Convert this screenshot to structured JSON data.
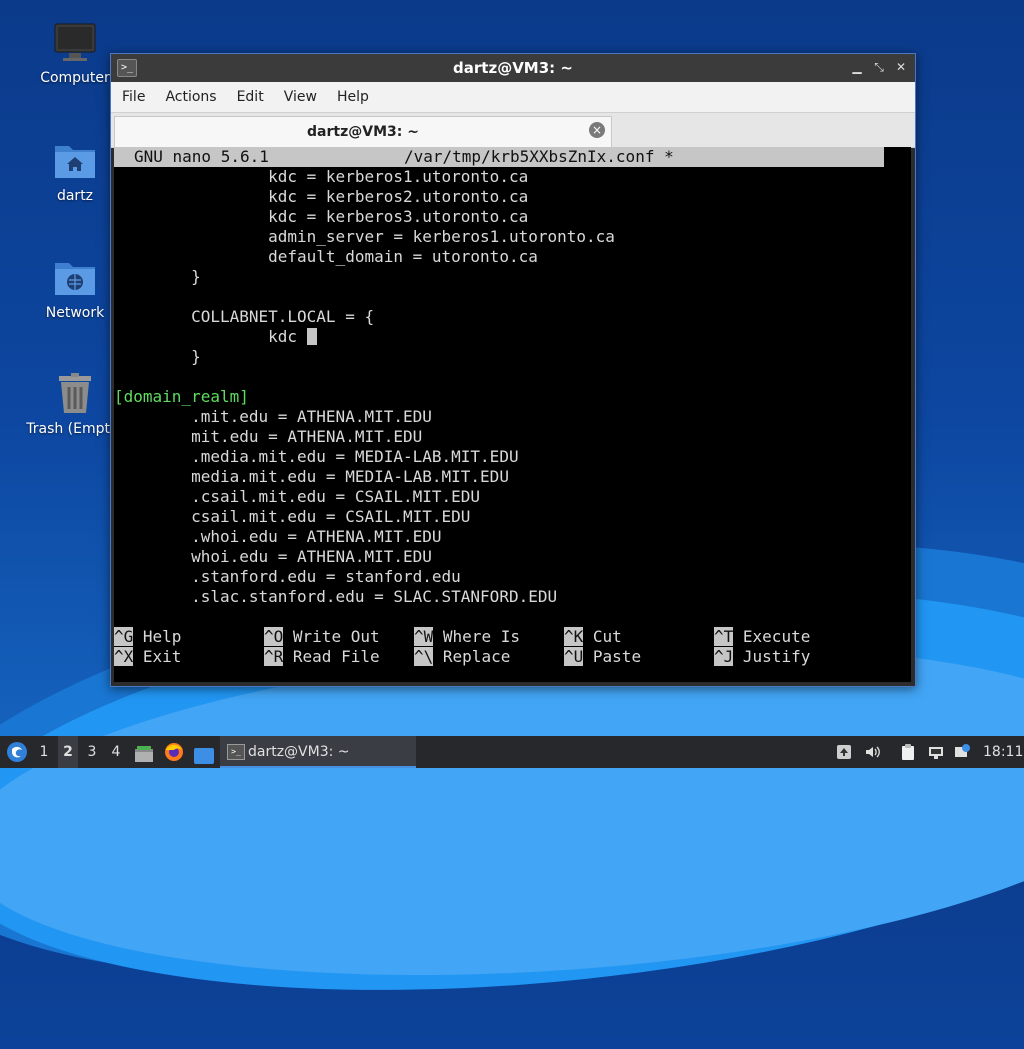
{
  "desktop": {
    "icons": [
      {
        "label": "Computer",
        "icon": "computer-icon"
      },
      {
        "label": "dartz",
        "icon": "home-folder-icon"
      },
      {
        "label": "Network",
        "icon": "network-folder-icon"
      },
      {
        "label": "Trash (Empty)",
        "icon": "trash-icon"
      }
    ]
  },
  "window": {
    "title": "dartz@VM3: ~",
    "menu": [
      "File",
      "Actions",
      "Edit",
      "View",
      "Help"
    ],
    "tab_label": "dartz@VM3: ~"
  },
  "nano": {
    "header_version": "GNU nano 5.6.1",
    "header_file": "/var/tmp/krb5XXbsZnIx.conf *",
    "lines": [
      "                kdc = kerberos1.utoronto.ca",
      "                kdc = kerberos2.utoronto.ca",
      "                kdc = kerberos3.utoronto.ca",
      "                admin_server = kerberos1.utoronto.ca",
      "                default_domain = utoronto.ca",
      "        }",
      "",
      "        COLLABNET.LOCAL = {",
      "                kdc ",
      "        }",
      "",
      "[domain_realm]",
      "        .mit.edu = ATHENA.MIT.EDU",
      "        mit.edu = ATHENA.MIT.EDU",
      "        .media.mit.edu = MEDIA-LAB.MIT.EDU",
      "        media.mit.edu = MEDIA-LAB.MIT.EDU",
      "        .csail.mit.edu = CSAIL.MIT.EDU",
      "        csail.mit.edu = CSAIL.MIT.EDU",
      "        .whoi.edu = ATHENA.MIT.EDU",
      "        whoi.edu = ATHENA.MIT.EDU",
      "        .stanford.edu = stanford.edu",
      "        .slac.stanford.edu = SLAC.STANFORD.EDU"
    ],
    "shortcuts_row1": [
      {
        "key": "^G",
        "label": "Help"
      },
      {
        "key": "^O",
        "label": "Write Out"
      },
      {
        "key": "^W",
        "label": "Where Is"
      },
      {
        "key": "^K",
        "label": "Cut"
      },
      {
        "key": "^T",
        "label": "Execute"
      }
    ],
    "shortcuts_row2": [
      {
        "key": "^X",
        "label": "Exit"
      },
      {
        "key": "^R",
        "label": "Read File"
      },
      {
        "key": "^\\",
        "label": "Replace"
      },
      {
        "key": "^U",
        "label": "Paste"
      },
      {
        "key": "^J",
        "label": "Justify"
      }
    ]
  },
  "taskbar": {
    "workspaces": [
      "1",
      "2",
      "3",
      "4"
    ],
    "active_workspace": "2",
    "task_title": "dartz@VM3: ~",
    "clock": "18:11"
  },
  "colors": {
    "desktop_bg": "#0d47a1",
    "window_border": "#4a78c2",
    "terminal_bg": "#000000",
    "section_header": "#5fdc5f",
    "nano_bar": "#c6c6c6"
  }
}
